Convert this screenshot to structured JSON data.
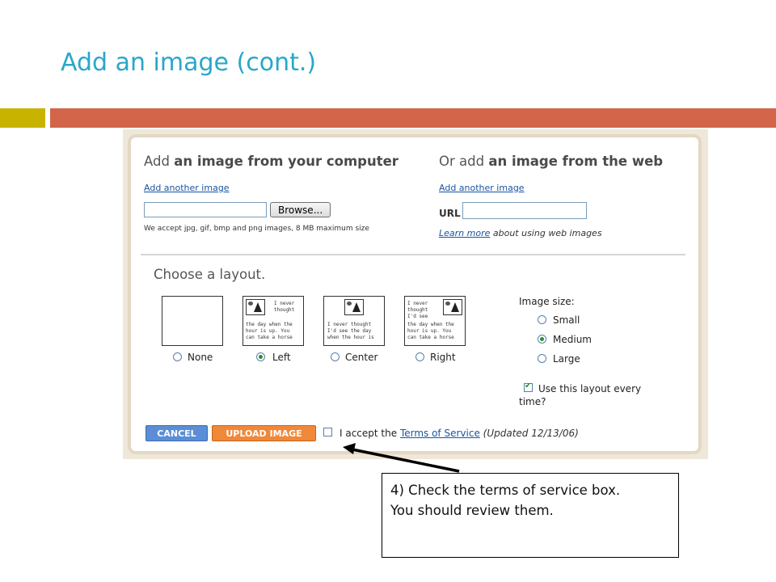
{
  "slide": {
    "title": "Add an image (cont.)",
    "colors": {
      "title": "#2aa7c9",
      "bar_left": "#c8b400",
      "bar_right": "#d2654a"
    }
  },
  "upload": {
    "computer": {
      "title_plain": "Add ",
      "title_bold": "an image from your computer",
      "add_another": "Add another image",
      "browse_label": "Browse...",
      "file_value": "",
      "note": "We accept jpg, gif, bmp and png images, 8 MB maximum size"
    },
    "web": {
      "title_plain": "Or add ",
      "title_bold": "an image from the web",
      "add_another": "Add another image",
      "url_label": "URL",
      "url_value": "",
      "learn_more": "Learn more",
      "learn_rest": " about using web images"
    },
    "layout": {
      "title": "Choose a layout.",
      "options": [
        {
          "label": "None",
          "selected": false
        },
        {
          "label": "Left",
          "selected": true
        },
        {
          "label": "Center",
          "selected": false
        },
        {
          "label": "Right",
          "selected": false
        }
      ],
      "thumb_text": {
        "left_top": "I never\nthought",
        "left_bottom": "the day when the\nhour is up. You\ncan take a horse",
        "center_bottom": "I never thought\nI'd see the day\nwhen the hour is",
        "right_top": "I never\nthought\nI'd see",
        "right_bottom": "the day when the\nhour is up. You\ncan take a horse"
      },
      "image_size": {
        "title": "Image size:",
        "options": [
          {
            "label": "Small",
            "selected": false
          },
          {
            "label": "Medium",
            "selected": true
          },
          {
            "label": "Large",
            "selected": false
          }
        ]
      },
      "remember": {
        "label": "Use this layout every time?",
        "checked": true
      }
    },
    "actions": {
      "cancel": "CANCEL",
      "upload": "UPLOAD IMAGE",
      "accept_prefix": "I accept the ",
      "tos_link": "Terms of Service",
      "updated": " (Updated 12/13/06)",
      "tos_checked": false
    }
  },
  "callout": {
    "line1": "4) Check the terms of service box.",
    "line2": "You should review them."
  }
}
